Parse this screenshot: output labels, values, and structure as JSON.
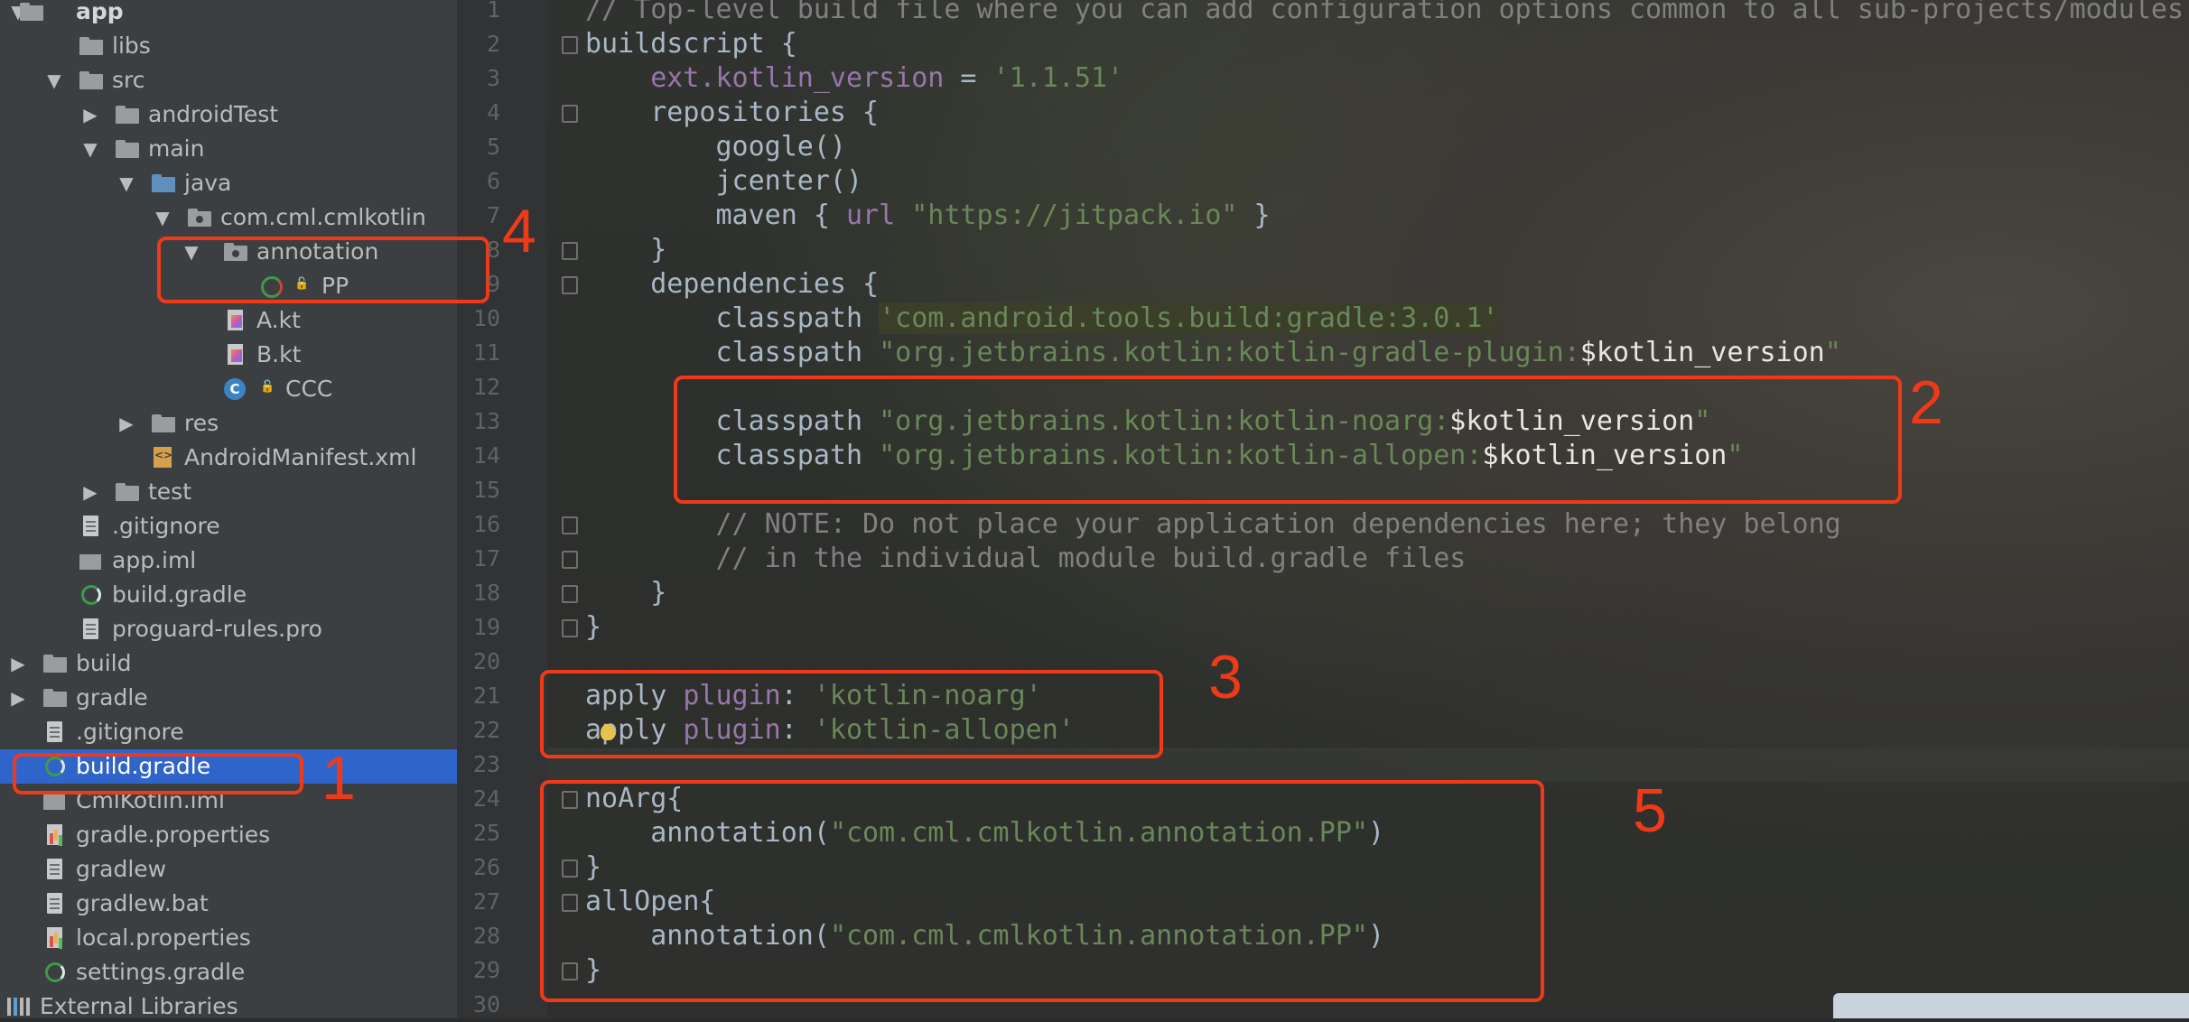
{
  "sidebar": {
    "items": [
      {
        "label": "app",
        "arrow": "▼",
        "icon": "folder-icon",
        "bold": true
      },
      {
        "label": "libs",
        "arrow": "",
        "icon": "folder-icon"
      },
      {
        "label": "src",
        "arrow": "▼",
        "icon": "folder-icon"
      },
      {
        "label": "androidTest",
        "arrow": "▶",
        "icon": "folder-icon"
      },
      {
        "label": "main",
        "arrow": "▼",
        "icon": "folder-icon"
      },
      {
        "label": "java",
        "arrow": "▼",
        "icon": "source-folder-icon"
      },
      {
        "label": "com.cml.cmlkotlin",
        "arrow": "▼",
        "icon": "package-icon"
      },
      {
        "label": "annotation",
        "arrow": "▼",
        "icon": "package-icon"
      },
      {
        "label": "PP",
        "arrow": "",
        "icon": "annotation-class-icon"
      },
      {
        "label": "A.kt",
        "arrow": "",
        "icon": "kotlin-file-icon"
      },
      {
        "label": "B.kt",
        "arrow": "",
        "icon": "kotlin-file-icon"
      },
      {
        "label": "CCC",
        "arrow": "",
        "icon": "class-icon"
      },
      {
        "label": "res",
        "arrow": "▶",
        "icon": "res-folder-icon"
      },
      {
        "label": "AndroidManifest.xml",
        "arrow": "",
        "icon": "xml-file-icon"
      },
      {
        "label": "test",
        "arrow": "▶",
        "icon": "folder-icon"
      },
      {
        "label": ".gitignore",
        "arrow": "",
        "icon": "text-file-icon"
      },
      {
        "label": "app.iml",
        "arrow": "",
        "icon": "module-file-icon"
      },
      {
        "label": "build.gradle",
        "arrow": "",
        "icon": "gradle-icon"
      },
      {
        "label": "proguard-rules.pro",
        "arrow": "",
        "icon": "text-file-icon"
      },
      {
        "label": "build",
        "arrow": "▶",
        "icon": "folder-icon"
      },
      {
        "label": "gradle",
        "arrow": "▶",
        "icon": "folder-icon"
      },
      {
        "label": ".gitignore",
        "arrow": "",
        "icon": "text-file-icon"
      },
      {
        "label": "build.gradle",
        "arrow": "",
        "icon": "gradle-icon",
        "selected": true
      },
      {
        "label": "CmlKotlin.iml",
        "arrow": "",
        "icon": "module-file-icon"
      },
      {
        "label": "gradle.properties",
        "arrow": "",
        "icon": "properties-file-icon"
      },
      {
        "label": "gradlew",
        "arrow": "",
        "icon": "text-file-icon"
      },
      {
        "label": "gradlew.bat",
        "arrow": "",
        "icon": "text-file-icon"
      },
      {
        "label": "local.properties",
        "arrow": "",
        "icon": "properties-file-icon"
      },
      {
        "label": "settings.gradle",
        "arrow": "",
        "icon": "gradle-icon"
      },
      {
        "label": "External Libraries",
        "arrow": "",
        "icon": "external-libraries-icon"
      }
    ]
  },
  "editor": {
    "line_numbers": [
      "1",
      "2",
      "3",
      "4",
      "5",
      "6",
      "7",
      "8",
      "9",
      "10",
      "11",
      "12",
      "13",
      "14",
      "15",
      "16",
      "17",
      "18",
      "19",
      "20",
      "21",
      "22",
      "23",
      "24",
      "25",
      "26",
      "27",
      "28",
      "29",
      "30"
    ],
    "lines": {
      "l1": "// Top-level build file where you can add configuration options common to all sub-projects/modules.",
      "l2": "buildscript {",
      "l3a": "ext.kotlin_version",
      "l3b": " = ",
      "l3c": "'1.1.51'",
      "l4": "repositories {",
      "l5": "google()",
      "l6": "jcenter()",
      "l7a": "maven { ",
      "l7b": "url",
      "l7c": " \"https://jitpack.io\"",
      "l7d": " }",
      "l8": "}",
      "l9": "dependencies {",
      "l10a": "classpath ",
      "l10b": "'com.android.tools.build:gradle:3.0.1'",
      "l11a": "classpath ",
      "l11b": "\"org.jetbrains.kotlin:kotlin-gradle-plugin:",
      "l11c": "$kotlin_version",
      "l11d": "\"",
      "l13a": "classpath ",
      "l13b": "\"org.jetbrains.kotlin:kotlin-noarg:",
      "l13c": "$kotlin_version",
      "l13d": "\"",
      "l14a": "classpath ",
      "l14b": "\"org.jetbrains.kotlin:kotlin-allopen:",
      "l14c": "$kotlin_version",
      "l14d": "\"",
      "l16": "// NOTE: Do not place your application dependencies here; they belong",
      "l17": "// in the individual module build.gradle files",
      "l18": "}",
      "l19": "}",
      "l21a": "apply ",
      "l21b": "plugin",
      "l21c": ": ",
      "l21d": "'kotlin-noarg'",
      "l22a": "apply ",
      "l22b": "plugin",
      "l22c": ": ",
      "l22d": "'kotlin-allopen'",
      "l24": "noArg{",
      "l25a": "annotation(",
      "l25b": "\"com.cml.cmlkotlin.annotation.PP\"",
      "l25c": ")",
      "l26": "}",
      "l27": "allOpen{",
      "l28a": "annotation(",
      "l28b": "\"com.cml.cmlkotlin.annotation.PP\"",
      "l28c": ")",
      "l29": "}"
    }
  },
  "annotations": {
    "n1": "1",
    "n2": "2",
    "n3": "3",
    "n4": "4",
    "n5": "5",
    "color": "#f03a17"
  },
  "colors": {
    "keyword": "#cc7832",
    "string": "#6a8759",
    "comment": "#808080",
    "property": "#9876aa",
    "text": "#a9b7c6",
    "selection": "#2f65ca"
  }
}
